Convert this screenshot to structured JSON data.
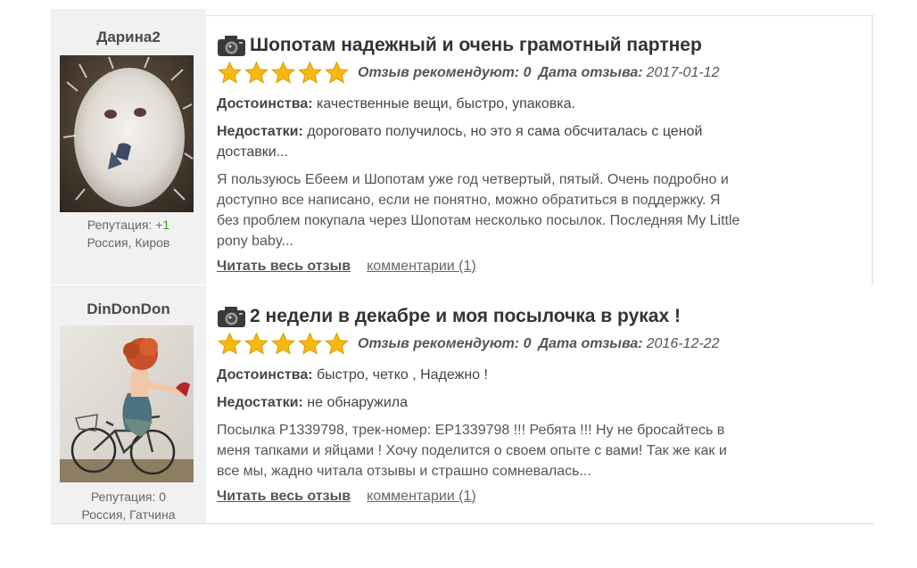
{
  "reviews": [
    {
      "author": "Дарина2",
      "reputation_label": "Репутация:",
      "reputation_value": "+1",
      "location": "Россия, Киров",
      "title": "Шопотам надежный и очень грамотный партнер",
      "stars": 5,
      "recommend_text": "Отзыв рекомендуют: 0",
      "date_label": "Дата отзыва:",
      "date": "2017-01-12",
      "pros_label": "Достоинства:",
      "pros": "качественные вещи, быстро, упаковка.",
      "cons_label": "Недостатки:",
      "cons_lines": [
        "дороговато получилось, но это я сама обсчиталась с ценой",
        "доставки..."
      ],
      "text_lines": [
        "Я пользуюсь Ебеем и Шопотам уже год четвертый, пятый. Очень подробно и",
        "доступно все написано, если не понятно, можно обратиться в поддержку. Я",
        "без проблем покупала через Шопотам несколько посылок. Последняя My Little",
        "pony baby..."
      ],
      "read_more": "Читать весь отзыв",
      "comments": "комментарии (1)"
    },
    {
      "author": "DinDonDon",
      "reputation_label": "Репутация:",
      "reputation_value": "0",
      "location": "Россия, Гатчина",
      "title": "2 недели в декабре и моя посылочка в руках !",
      "stars": 5,
      "recommend_text": "Отзыв рекомендуют: 0",
      "date_label": "Дата отзыва:",
      "date": "2016-12-22",
      "pros_label": "Достоинства:",
      "pros": "быстро, четко , Надежно !",
      "cons_label": "Недостатки:",
      "cons_lines": [
        "не обнаружила"
      ],
      "text_lines": [
        "Посылка P1339798, трек-номер: EP1339798 !!! Ребята !!! Ну не бросайтесь в",
        "меня тапками и яйцами ! Хочу поделится о своем опыте с вами! Так же как и",
        "все мы, жадно читала отзывы и страшно сомневалась..."
      ],
      "read_more": "Читать весь отзыв",
      "comments": "комментарии (1)"
    }
  ],
  "colors": {
    "star": "#f7b90f",
    "reputation_positive": "#3a9a2a",
    "sidebar_bg": "#f1f1f1"
  },
  "icons": {
    "title_icon": "camera-icon",
    "rating_icon": "star-icon"
  }
}
